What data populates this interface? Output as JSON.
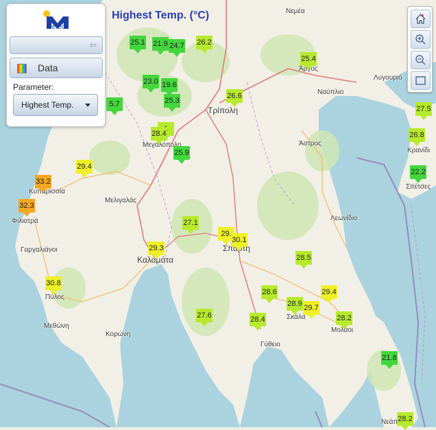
{
  "title": "Highest Temp. (°C)",
  "panel": {
    "logo_text": "Meteo",
    "data_label": "Data",
    "parameter_label": "Parameter:",
    "parameter_value": "Highest Temp."
  },
  "colors": {
    "sea": "#aad3df",
    "land": "#f2efe6",
    "green": "#43d63d",
    "yellowgreen": "#b7ea2c",
    "yellow": "#eef027",
    "orange": "#f5a623"
  },
  "places": [
    {
      "name": "Νεμέα",
      "cls": ""
    },
    {
      "name": "Άργος",
      "cls": ""
    },
    {
      "name": "Λυγουριό",
      "cls": ""
    },
    {
      "name": "Ναύπλιο",
      "cls": ""
    },
    {
      "name": "Τρίπολη",
      "cls": "big"
    },
    {
      "name": "Άστρος",
      "cls": ""
    },
    {
      "name": "Κρανίδι",
      "cls": ""
    },
    {
      "name": "Σπέτσες",
      "cls": ""
    },
    {
      "name": "Μεγαλόπολη",
      "cls": ""
    },
    {
      "name": "Κυπαρισσία",
      "cls": ""
    },
    {
      "name": "Μελιγαλάς",
      "cls": ""
    },
    {
      "name": "Φιλιατρά",
      "cls": ""
    },
    {
      "name": "Γαργαλιάνοι",
      "cls": ""
    },
    {
      "name": "Λεωνίδιο",
      "cls": ""
    },
    {
      "name": "Καλαμάτα",
      "cls": "big"
    },
    {
      "name": "Σπάρτη",
      "cls": "big"
    },
    {
      "name": "Πύλος",
      "cls": ""
    },
    {
      "name": "Μεθώνη",
      "cls": ""
    },
    {
      "name": "Κορώνη",
      "cls": ""
    },
    {
      "name": "Σκάλα",
      "cls": ""
    },
    {
      "name": "Μολάοι",
      "cls": ""
    },
    {
      "name": "Γύθειο",
      "cls": ""
    },
    {
      "name": "Νεάπολη",
      "cls": ""
    }
  ],
  "markers": [
    {
      "value": "25.1",
      "color": "green"
    },
    {
      "value": "21.9",
      "color": "green"
    },
    {
      "value": "24.7",
      "color": "green"
    },
    {
      "value": "26.2",
      "color": "yellowgreen"
    },
    {
      "value": "25.4",
      "color": "yellowgreen"
    },
    {
      "value": "23.0",
      "color": "green"
    },
    {
      "value": "19.6",
      "color": "green"
    },
    {
      "value": "25.3",
      "color": "green"
    },
    {
      "value": "26.6",
      "color": "yellowgreen"
    },
    {
      "value": "5.7",
      "color": "green"
    },
    {
      "value": "27.5",
      "color": "yellowgreen"
    },
    {
      "value": "1",
      "color": "yellowgreen"
    },
    {
      "value": "28.4",
      "color": "yellowgreen"
    },
    {
      "value": "26.8",
      "color": "yellowgreen"
    },
    {
      "value": "25.9",
      "color": "green"
    },
    {
      "value": "29.4",
      "color": "yellow"
    },
    {
      "value": "22.2",
      "color": "green"
    },
    {
      "value": "33.2",
      "color": "orange"
    },
    {
      "value": "32.3",
      "color": "orange"
    },
    {
      "value": "27.1",
      "color": "yellowgreen"
    },
    {
      "value": "29.",
      "color": "yellow"
    },
    {
      "value": "30.1",
      "color": "yellow"
    },
    {
      "value": "29.3",
      "color": "yellow"
    },
    {
      "value": "28.5",
      "color": "yellowgreen"
    },
    {
      "value": "30.8",
      "color": "yellow"
    },
    {
      "value": "28.6",
      "color": "yellowgreen"
    },
    {
      "value": "28.9",
      "color": "yellowgreen"
    },
    {
      "value": "29.7",
      "color": "yellow"
    },
    {
      "value": "29.4",
      "color": "yellow"
    },
    {
      "value": "27.6",
      "color": "yellowgreen"
    },
    {
      "value": "28.4",
      "color": "yellowgreen"
    },
    {
      "value": "28.2",
      "color": "yellowgreen"
    },
    {
      "value": "21.8",
      "color": "green"
    },
    {
      "value": "28.2",
      "color": "yellowgreen"
    }
  ]
}
